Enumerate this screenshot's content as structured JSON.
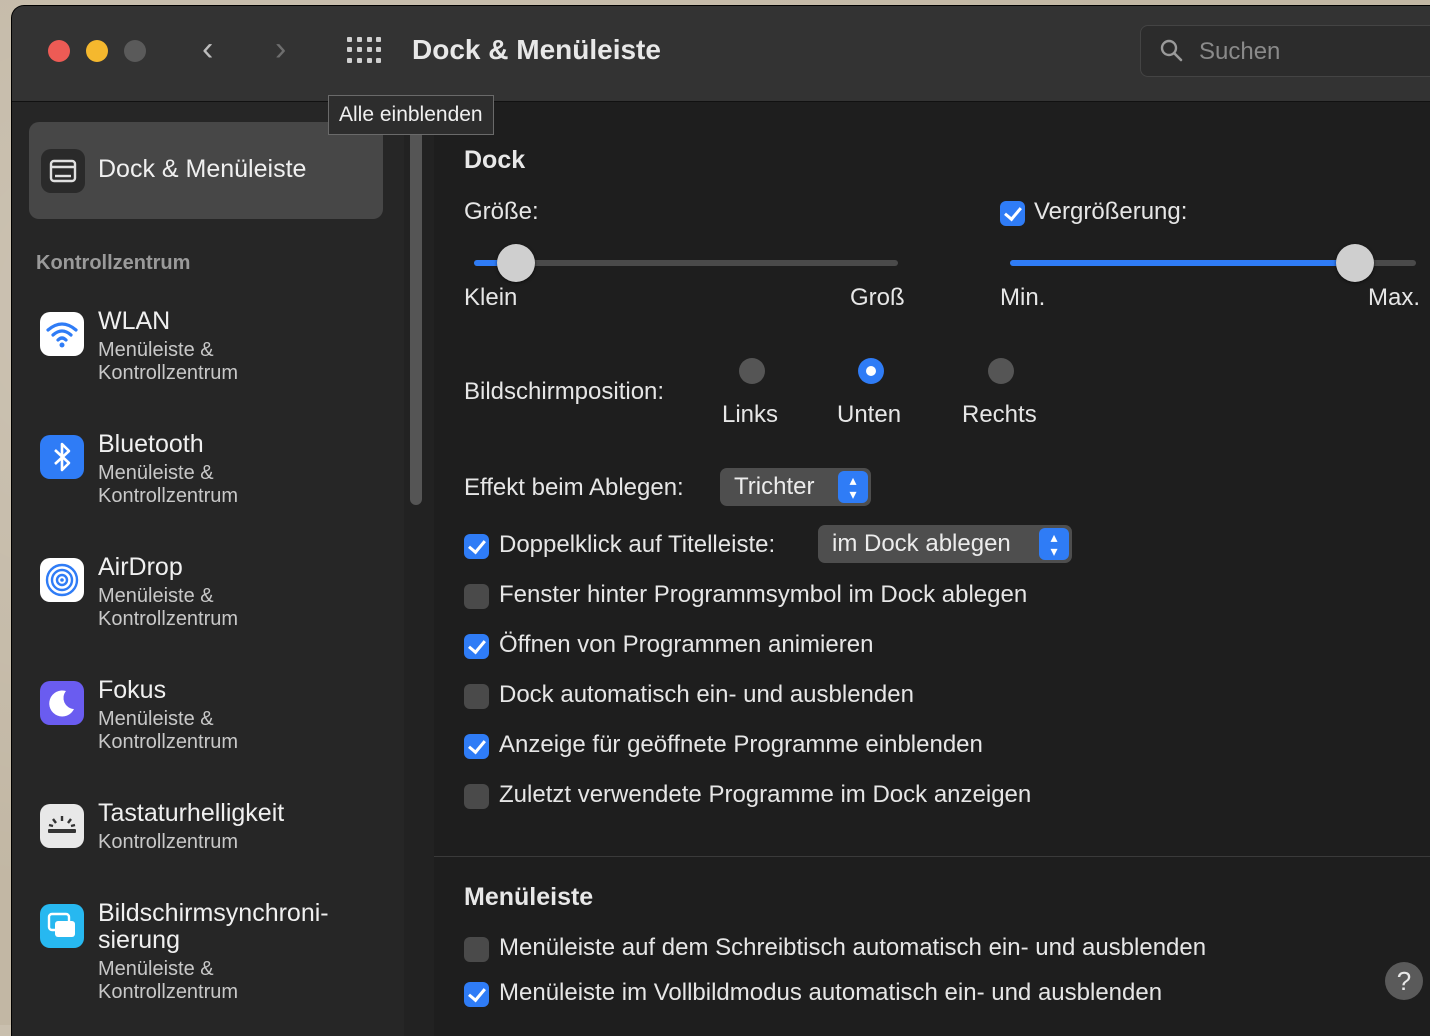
{
  "window": {
    "title": "Dock & Menüleiste",
    "search_placeholder": "Suchen",
    "tooltip": "Alle einblenden",
    "nav_back": "‹",
    "nav_forward": "›"
  },
  "sidebar": {
    "selected": {
      "label": "Dock & Menüleiste",
      "icon": "dock-icon"
    },
    "section_title": "Kontrollzentrum",
    "items": [
      {
        "title": "WLAN",
        "sub1": "Menüleiste &",
        "sub2": "Kontrollzentrum",
        "icon": "wifi-icon",
        "color": "#ffffff"
      },
      {
        "title": "Bluetooth",
        "sub1": "Menüleiste &",
        "sub2": "Kontrollzentrum",
        "icon": "bluetooth-icon",
        "color": "#2f7cf6"
      },
      {
        "title": "AirDrop",
        "sub1": "Menüleiste &",
        "sub2": "Kontrollzentrum",
        "icon": "airdrop-icon",
        "color": "#ffffff"
      },
      {
        "title": "Fokus",
        "sub1": "Menüleiste &",
        "sub2": "Kontrollzentrum",
        "icon": "moon-icon",
        "color": "#6a5cf0"
      },
      {
        "title": "Tastaturhelligkeit",
        "sub1": "Kontrollzentrum",
        "sub2": "",
        "icon": "keyboard-brightness-icon",
        "color": "#e8e8e8"
      },
      {
        "title": "Bildschirmsynchroni-",
        "title2": "sierung",
        "sub1": "Menüleiste &",
        "sub2": "Kontrollzentrum",
        "icon": "screen-mirroring-icon",
        "color": "#27b8f0"
      }
    ]
  },
  "dock": {
    "heading": "Dock",
    "size_label": "Größe:",
    "size_min": "Klein",
    "size_max": "Groß",
    "size_value": 0.1,
    "magnification_label": "Vergrößerung:",
    "magnification_checked": true,
    "mag_min": "Min.",
    "mag_max": "Max.",
    "mag_value": 0.85,
    "position_label": "Bildschirmposition:",
    "position_options": [
      "Links",
      "Unten",
      "Rechts"
    ],
    "position_selected": "Unten",
    "effect_label": "Effekt beim Ablegen:",
    "effect_value": "Trichter",
    "doubleclick_label": "Doppelklick auf Titelleiste:",
    "doubleclick_checked": true,
    "doubleclick_value": "im Dock ablegen",
    "options": [
      {
        "label": "Fenster hinter Programmsymbol im Dock ablegen",
        "checked": false
      },
      {
        "label": "Öffnen von Programmen animieren",
        "checked": true
      },
      {
        "label": "Dock automatisch ein- und ausblenden",
        "checked": false
      },
      {
        "label": "Anzeige für geöffnete Programme einblenden",
        "checked": true
      },
      {
        "label": "Zuletzt verwendete Programme im Dock anzeigen",
        "checked": false
      }
    ]
  },
  "menubar": {
    "heading": "Menüleiste",
    "options": [
      {
        "label": "Menüleiste auf dem Schreibtisch automatisch ein- und ausblenden",
        "checked": false
      },
      {
        "label": "Menüleiste im Vollbildmodus automatisch ein- und ausblenden",
        "checked": true
      }
    ]
  },
  "help": {
    "label": "?"
  },
  "colors": {
    "accent": "#2f7cf6",
    "background": "#1e1e1e",
    "sidebar": "#262626"
  }
}
